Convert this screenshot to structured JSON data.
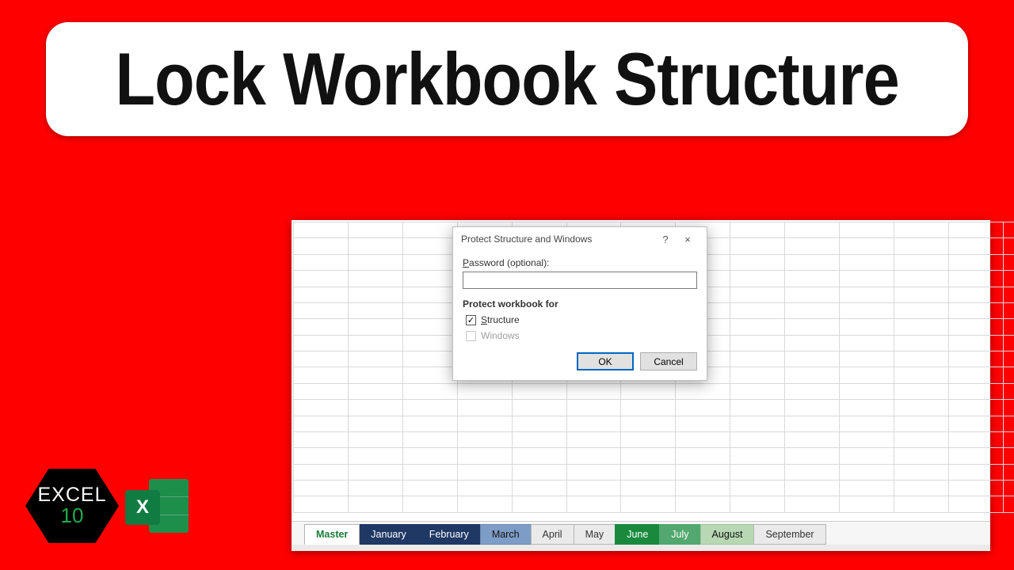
{
  "title": "Lock Workbook Structure",
  "dialog": {
    "title": "Protect Structure and Windows",
    "help": "?",
    "close": "×",
    "password_label_pre": "P",
    "password_label_rest": "assword (optional):",
    "password_value": "",
    "group_label": "Protect workbook for",
    "cb_structure_pre": "S",
    "cb_structure_rest": "tructure",
    "cb_structure_checked": "✓",
    "cb_windows_label": "Windows",
    "ok": "OK",
    "cancel": "Cancel"
  },
  "tabs": {
    "master": "Master",
    "jan": "January",
    "feb": "February",
    "mar": "March",
    "apr": "April",
    "may": "May",
    "jun": "June",
    "jul": "July",
    "aug": "August",
    "sep": "September"
  },
  "logo": {
    "line1": "EXCEL",
    "line2": "10",
    "x": "X"
  }
}
